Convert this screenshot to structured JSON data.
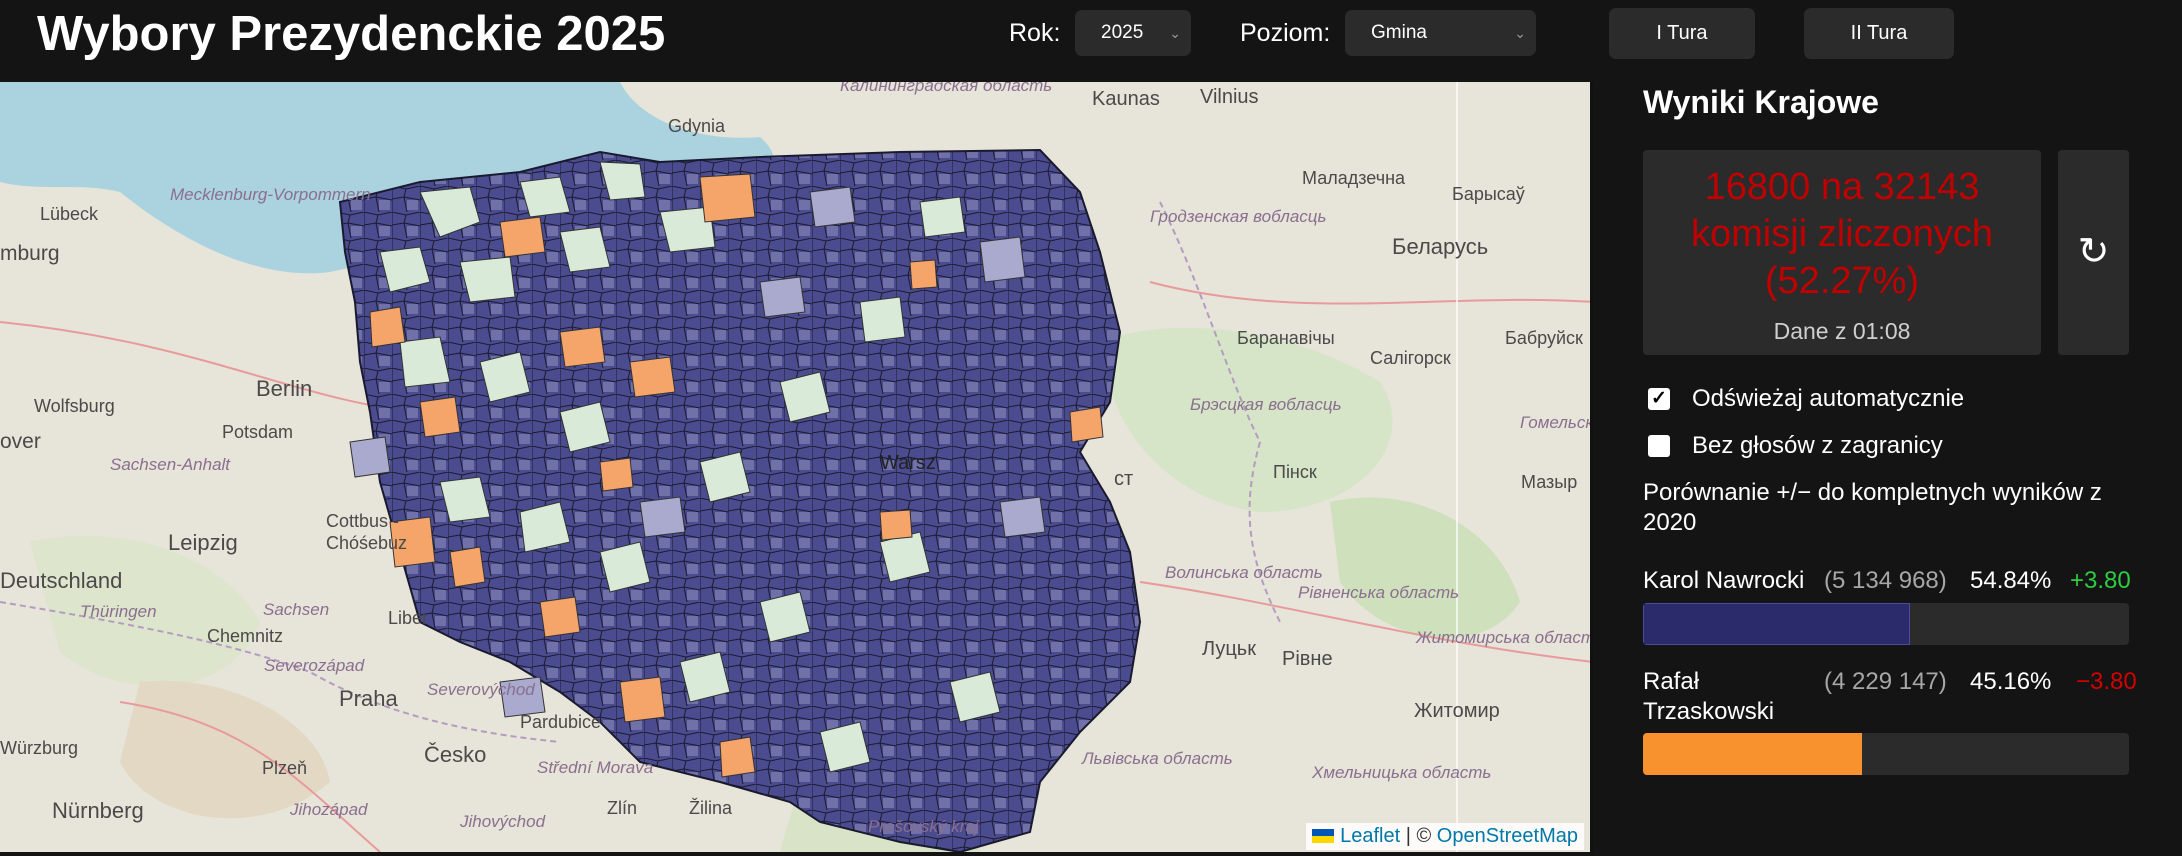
{
  "header": {
    "title": "Wybory Prezydenckie 2025",
    "year_label": "Rok:",
    "year_value": "2025",
    "level_label": "Poziom:",
    "level_value": "Gmina",
    "round1_label": "I Tura",
    "round2_label": "II Tura"
  },
  "map": {
    "labels": {
      "kaliningrad": "Калининградская область",
      "kaunas": "Kaunas",
      "vilnius": "Vilnius",
      "gdynia": "Gdynia",
      "maladzechna": "Маладзечна",
      "barysau": "Барысаў",
      "lubeck": "Lübeck",
      "mecklenburg": "Mecklenburg-Vorpommern",
      "hamburg": "mburg",
      "hrodna_obl": "Гродзенская вобласць",
      "belarus": "Беларусь",
      "berlin": "Berlin",
      "baranavichy": "Баранавічы",
      "salihorsk": "Салігорск",
      "babruysk": "Бабруйск",
      "wolfsburg": "Wolfsburg",
      "potsdam": "Potsdam",
      "brest_obl": "Брэсцкая вобласць",
      "homel_obl": "Гомельская вобласць",
      "hanover": "over",
      "sachsen_anhalt": "Sachsen-Anhalt",
      "pinsk": "Пінск",
      "mazyr": "Мазыр",
      "brest": "ст",
      "warsaw": "Warsz",
      "cottbus": "Cottbus - Chóśebuz",
      "leipzig": "Leipzig",
      "deutschland": "Deutschland",
      "volyn_obl": "Волинська область",
      "rivne_obl": "Рівненська область",
      "zhytomyr_obl": "Житомирська область",
      "thuringen": "Thüringen",
      "sachsen": "Sachsen",
      "chemnitz": "Chemnitz",
      "liberec": "Liber",
      "lutsk": "Луцьк",
      "rivne": "Рівне",
      "severozapad": "Severozápad",
      "severovychod": "Severovýchod",
      "praha": "Praha",
      "pardubice": "Pardubice",
      "zhytomyr": "Житомир",
      "wurzburg": "Würzburg",
      "cesko": "Česko",
      "lviv_obl": "Львівська область",
      "khmelnytskyi_obl": "Хмельницька область",
      "plzen": "Plzeň",
      "stredni_morava": "Střední Morava",
      "nurnberg": "Nürnberg",
      "jihozapad": "Jihozápad",
      "jihovychod": "Jihovýchod",
      "zlin": "Zlín",
      "zilina": "Žilina",
      "presovsky": "Prešovský kraj"
    },
    "attribution": {
      "leaflet": "Leaflet",
      "separator": " | © ",
      "osm": "OpenStreetMap"
    }
  },
  "panel": {
    "title": "Wyniki Krajowe",
    "count_text": "16800 na 32143 komisji zliczonych (52.27%)",
    "count_time": "Dane z 01:08",
    "refresh_icon": "↻",
    "auto_refresh_label": "Odświeżaj automatycznie",
    "auto_refresh_checked": true,
    "no_abroad_label": "Bez głosów z zagranicy",
    "no_abroad_checked": false,
    "compare_note": "Porównanie +/− do kompletnych wyników z 2020",
    "candidates": [
      {
        "name": "Karol Nawrocki",
        "votes": "(5 134 968)",
        "pct": "54.84%",
        "diff": "+3.80",
        "share": 54.84,
        "color": "#2b2a6b",
        "diff_color": "#2ecc40"
      },
      {
        "name": "Rafał Trzaskowski",
        "votes": "(4 229 147)",
        "pct": "45.16%",
        "diff": "−3.80",
        "share": 45.16,
        "color": "#f7922f",
        "diff_color": "#d40000"
      }
    ]
  },
  "colors": {
    "background": "#141414",
    "control_bg": "#2b2b2b",
    "count_red": "#c00000",
    "nawrocki_dark": "#3a3a80",
    "nawrocki_mid": "#6e70a6",
    "nawrocki_light": "#a9aace",
    "neutral_light": "#d9ebd8",
    "trzaskowski": "#f5a46a",
    "sea": "#aad3df"
  }
}
